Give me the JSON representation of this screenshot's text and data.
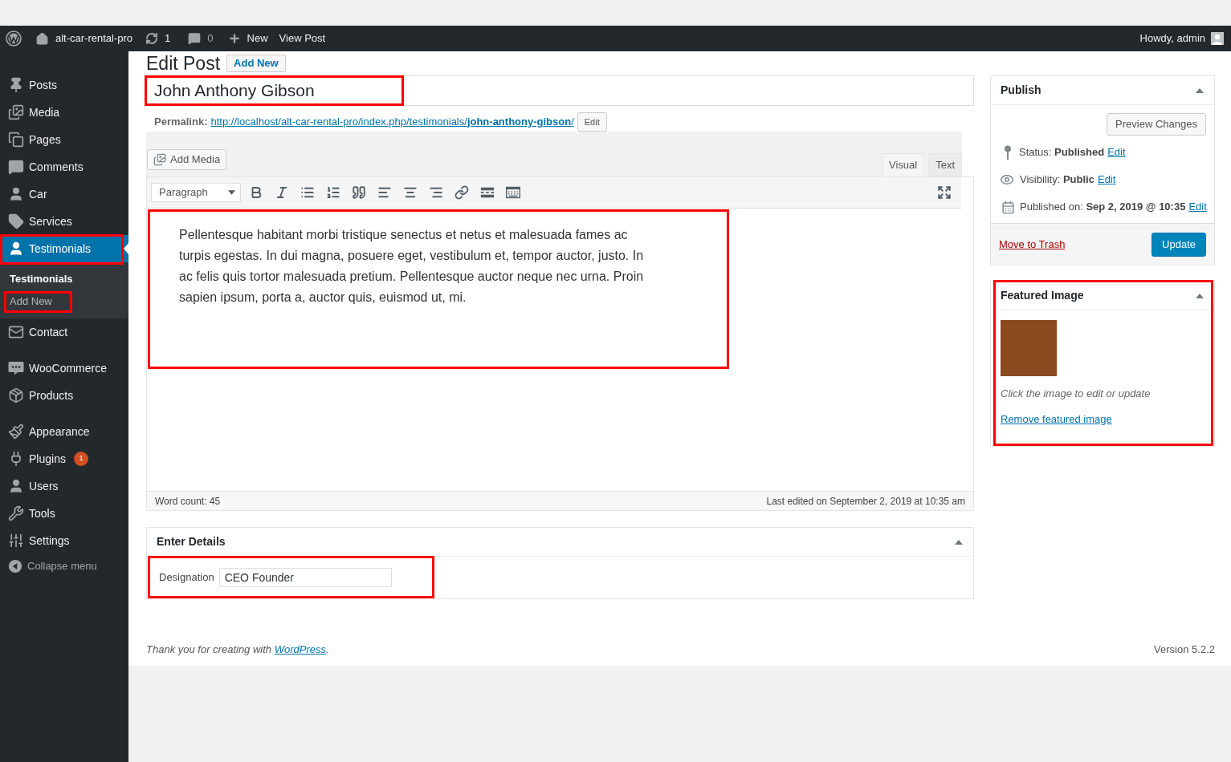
{
  "admin_bar": {
    "site_name": "alt-car-rental-pro",
    "updates_count": "1",
    "comments_count": "0",
    "new_label": "New",
    "view_post": "View Post",
    "greeting": "Howdy, admin"
  },
  "sidebar": {
    "groups": [
      {
        "items": [
          {
            "label": "Posts",
            "selected": false
          },
          {
            "label": "Media",
            "selected": false
          },
          {
            "label": "Pages",
            "selected": false
          },
          {
            "label": "Comments",
            "selected": false
          },
          {
            "label": "Car",
            "selected": false
          },
          {
            "label": "Services",
            "selected": false
          },
          {
            "label": "Testimonials",
            "selected": true,
            "highlighted": true,
            "submenu": [
              {
                "label": "Testimonials",
                "selected": true,
                "highlighted": false
              },
              {
                "label": "Add New",
                "selected": false,
                "highlighted": true
              }
            ]
          },
          {
            "label": "Contact",
            "selected": false
          }
        ]
      },
      {
        "items": [
          {
            "label": "WooCommerce",
            "selected": false
          },
          {
            "label": "Products",
            "selected": false
          }
        ]
      },
      {
        "items": [
          {
            "label": "Appearance",
            "selected": false
          },
          {
            "label": "Plugins",
            "selected": false,
            "badge": "1"
          },
          {
            "label": "Users",
            "selected": false
          },
          {
            "label": "Tools",
            "selected": false
          },
          {
            "label": "Settings",
            "selected": false
          }
        ]
      }
    ],
    "collapse_label": "Collapse menu"
  },
  "page": {
    "heading": "Edit Post",
    "add_new": "Add New"
  },
  "title_field": {
    "value": "John Anthony Gibson",
    "highlighted": true
  },
  "permalink": {
    "label": "Permalink:",
    "url": "http://localhost/alt-car-rental-pro/index.php/testimonials/**john-anthony-gibson**/",
    "edit": "Edit"
  },
  "editor": {
    "add_media": "Add Media",
    "tabs": [
      {
        "label": "Visual",
        "selected": true
      },
      {
        "label": "Text",
        "selected": false
      }
    ],
    "format_select": "Paragraph",
    "content": "Pellentesque habitant morbi tristique senectus et netus et malesuada fames ac turpis egestas. In dui magna, posuere eget, vestibulum et, tempor auctor, justo. In ac felis quis tortor malesuada pretium. Pellentesque auctor neque nec urna. Proin sapien ipsum, porta a, auctor quis, euismod ut, mi.",
    "highlighted": true,
    "word_count": "Word count: 45",
    "last_edited": "Last edited on September 2, 2019 at 10:35 am"
  },
  "details_box": {
    "title": "Enter Details",
    "fields": [
      {
        "label": "Designation",
        "value": "CEO Founder"
      }
    ],
    "highlighted": true
  },
  "publish_box": {
    "title": "Publish",
    "preview": "Preview Changes",
    "rows": [
      {
        "text": "Status: **Published**",
        "edit": "Edit"
      },
      {
        "text": "Visibility: **Public**",
        "edit": "Edit"
      },
      {
        "text": "Published on: **Sep 2, 2019 @ 10:35**",
        "edit": "Edit"
      }
    ],
    "trash": "Move to Trash",
    "update": "Update"
  },
  "featured_image_box": {
    "title": "Featured Image",
    "hint": "Click the image to edit or update",
    "remove": "Remove featured image",
    "highlighted": true
  },
  "footer": {
    "text": "Thank you for creating with",
    "link": "WordPress",
    "after": ".",
    "version": "Version 5.2.2"
  }
}
